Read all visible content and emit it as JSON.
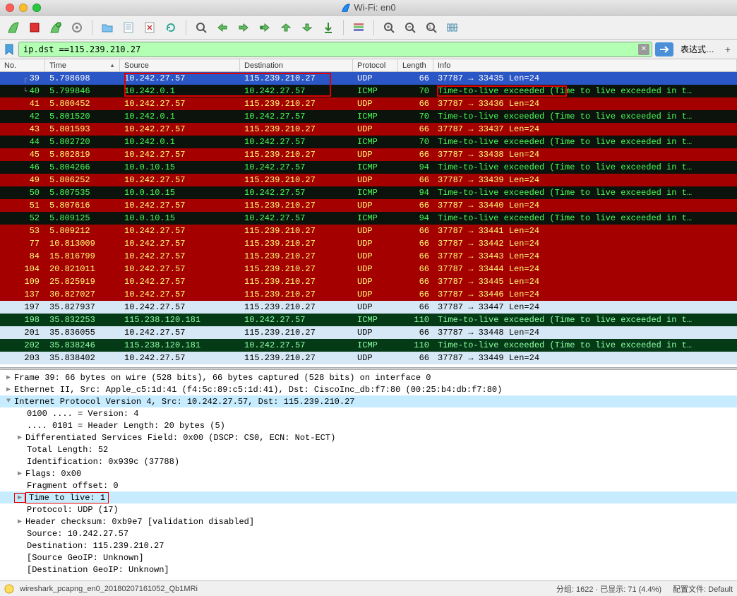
{
  "window": {
    "title": "Wi-Fi: en0"
  },
  "filter": {
    "value": "ip.dst ==115.239.210.27",
    "expr_label": "表达式…"
  },
  "columns": {
    "no": "No.",
    "time": "Time",
    "source": "Source",
    "destination": "Destination",
    "protocol": "Protocol",
    "length": "Length",
    "info": "Info"
  },
  "packets": [
    {
      "no": "39",
      "time": "5.798698",
      "src": "10.242.27.57",
      "dst": "115.239.210.27",
      "proto": "UDP",
      "len": "66",
      "info": "37787 → 33435  Len=24",
      "style": "selected"
    },
    {
      "no": "40",
      "time": "5.799846",
      "src": "10.242.0.1",
      "dst": "10.242.27.57",
      "proto": "ICMP",
      "len": "70",
      "info": "Time-to-live exceeded (Time to live exceeded in t…",
      "style": "black"
    },
    {
      "no": "41",
      "time": "5.800452",
      "src": "10.242.27.57",
      "dst": "115.239.210.27",
      "proto": "UDP",
      "len": "66",
      "info": "37787 → 33436  Len=24",
      "style": "red"
    },
    {
      "no": "42",
      "time": "5.801520",
      "src": "10.242.0.1",
      "dst": "10.242.27.57",
      "proto": "ICMP",
      "len": "70",
      "info": "Time-to-live exceeded (Time to live exceeded in t…",
      "style": "black"
    },
    {
      "no": "43",
      "time": "5.801593",
      "src": "10.242.27.57",
      "dst": "115.239.210.27",
      "proto": "UDP",
      "len": "66",
      "info": "37787 → 33437  Len=24",
      "style": "red"
    },
    {
      "no": "44",
      "time": "5.802720",
      "src": "10.242.0.1",
      "dst": "10.242.27.57",
      "proto": "ICMP",
      "len": "70",
      "info": "Time-to-live exceeded (Time to live exceeded in t…",
      "style": "black"
    },
    {
      "no": "45",
      "time": "5.802819",
      "src": "10.242.27.57",
      "dst": "115.239.210.27",
      "proto": "UDP",
      "len": "66",
      "info": "37787 → 33438  Len=24",
      "style": "red"
    },
    {
      "no": "46",
      "time": "5.804266",
      "src": "10.0.10.15",
      "dst": "10.242.27.57",
      "proto": "ICMP",
      "len": "94",
      "info": "Time-to-live exceeded (Time to live exceeded in t…",
      "style": "black"
    },
    {
      "no": "49",
      "time": "5.806252",
      "src": "10.242.27.57",
      "dst": "115.239.210.27",
      "proto": "UDP",
      "len": "66",
      "info": "37787 → 33439  Len=24",
      "style": "red"
    },
    {
      "no": "50",
      "time": "5.807535",
      "src": "10.0.10.15",
      "dst": "10.242.27.57",
      "proto": "ICMP",
      "len": "94",
      "info": "Time-to-live exceeded (Time to live exceeded in t…",
      "style": "black"
    },
    {
      "no": "51",
      "time": "5.807616",
      "src": "10.242.27.57",
      "dst": "115.239.210.27",
      "proto": "UDP",
      "len": "66",
      "info": "37787 → 33440  Len=24",
      "style": "red"
    },
    {
      "no": "52",
      "time": "5.809125",
      "src": "10.0.10.15",
      "dst": "10.242.27.57",
      "proto": "ICMP",
      "len": "94",
      "info": "Time-to-live exceeded (Time to live exceeded in t…",
      "style": "black"
    },
    {
      "no": "53",
      "time": "5.809212",
      "src": "10.242.27.57",
      "dst": "115.239.210.27",
      "proto": "UDP",
      "len": "66",
      "info": "37787 → 33441  Len=24",
      "style": "red"
    },
    {
      "no": "77",
      "time": "10.813009",
      "src": "10.242.27.57",
      "dst": "115.239.210.27",
      "proto": "UDP",
      "len": "66",
      "info": "37787 → 33442  Len=24",
      "style": "red"
    },
    {
      "no": "84",
      "time": "15.816799",
      "src": "10.242.27.57",
      "dst": "115.239.210.27",
      "proto": "UDP",
      "len": "66",
      "info": "37787 → 33443  Len=24",
      "style": "red"
    },
    {
      "no": "104",
      "time": "20.821011",
      "src": "10.242.27.57",
      "dst": "115.239.210.27",
      "proto": "UDP",
      "len": "66",
      "info": "37787 → 33444  Len=24",
      "style": "red"
    },
    {
      "no": "109",
      "time": "25.825919",
      "src": "10.242.27.57",
      "dst": "115.239.210.27",
      "proto": "UDP",
      "len": "66",
      "info": "37787 → 33445  Len=24",
      "style": "red"
    },
    {
      "no": "137",
      "time": "30.827027",
      "src": "10.242.27.57",
      "dst": "115.239.210.27",
      "proto": "UDP",
      "len": "66",
      "info": "37787 → 33446  Len=24",
      "style": "red"
    },
    {
      "no": "197",
      "time": "35.827937",
      "src": "10.242.27.57",
      "dst": "115.239.210.27",
      "proto": "UDP",
      "len": "66",
      "info": "37787 → 33447  Len=24",
      "style": "blue"
    },
    {
      "no": "198",
      "time": "35.832253",
      "src": "115.238.120.181",
      "dst": "10.242.27.57",
      "proto": "ICMP",
      "len": "110",
      "info": "Time-to-live exceeded (Time to live exceeded in t…",
      "style": "green"
    },
    {
      "no": "201",
      "time": "35.836055",
      "src": "10.242.27.57",
      "dst": "115.239.210.27",
      "proto": "UDP",
      "len": "66",
      "info": "37787 → 33448  Len=24",
      "style": "blue"
    },
    {
      "no": "202",
      "time": "35.838246",
      "src": "115.238.120.181",
      "dst": "10.242.27.57",
      "proto": "ICMP",
      "len": "110",
      "info": "Time-to-live exceeded (Time to live exceeded in t…",
      "style": "green"
    },
    {
      "no": "203",
      "time": "35.838402",
      "src": "10.242.27.57",
      "dst": "115.239.210.27",
      "proto": "UDP",
      "len": "66",
      "info": "37787 → 33449  Len=24",
      "style": "blue"
    }
  ],
  "details": {
    "l0": "Frame 39: 66 bytes on wire (528 bits), 66 bytes captured (528 bits) on interface 0",
    "l1": "Ethernet II, Src: Apple_c5:1d:41 (f4:5c:89:c5:1d:41), Dst: CiscoInc_db:f7:80 (00:25:b4:db:f7:80)",
    "l2": "Internet Protocol Version 4, Src: 10.242.27.57, Dst: 115.239.210.27",
    "l3": "0100 .... = Version: 4",
    "l4": ".... 0101 = Header Length: 20 bytes (5)",
    "l5": "Differentiated Services Field: 0x00 (DSCP: CS0, ECN: Not-ECT)",
    "l6": "Total Length: 52",
    "l7": "Identification: 0x939c (37788)",
    "l8": "Flags: 0x00",
    "l9": "Fragment offset: 0",
    "l10": "Time to live: 1",
    "l11": "Protocol: UDP (17)",
    "l12": "Header checksum: 0xb9e7 [validation disabled]",
    "l13": "Source: 10.242.27.57",
    "l14": "Destination: 115.239.210.27",
    "l15": "[Source GeoIP: Unknown]",
    "l16": "[Destination GeoIP: Unknown]"
  },
  "status": {
    "filename": "wireshark_pcapng_en0_20180207161052_Qb1MRi",
    "packets": "分组: 1622 · 已显示: 71 (4.4%)",
    "profile": "配置文件: Default"
  },
  "icons": {
    "sharkfin": "sharkfin",
    "stop": "stop",
    "restart": "restart",
    "options": "options",
    "open": "open",
    "save": "save",
    "close": "close",
    "reload": "reload",
    "find": "find",
    "prev": "prev",
    "next": "next",
    "jump": "jump",
    "first": "first",
    "last": "last",
    "autoscroll": "autoscroll",
    "colorize": "colorize",
    "zoomin": "zoomin",
    "zoomout": "zoomout",
    "zoomreset": "zoomreset",
    "resize": "resize"
  }
}
